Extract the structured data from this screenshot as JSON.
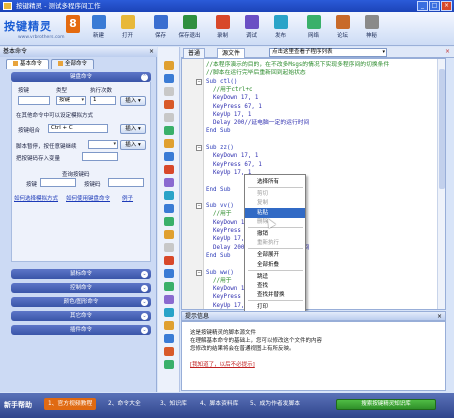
{
  "window": {
    "title": "按键精灵 - 测试多程序间工作"
  },
  "logo": {
    "text": "按键精灵",
    "version": "8",
    "url": "www.vrbrothers.com"
  },
  "toolbar": {
    "buttons": [
      {
        "label": "新建",
        "icon": "new-file-icon",
        "color": "#3a7bd5"
      },
      {
        "label": "打开",
        "icon": "open-folder-icon",
        "color": "#e8b83a"
      },
      {
        "label": "保存",
        "icon": "save-icon",
        "color": "#3a6ed0"
      },
      {
        "label": "保存退出",
        "icon": "save-exit-icon",
        "color": "#2f8f3f"
      },
      {
        "label": "录制",
        "icon": "record-icon",
        "color": "#d8482a"
      },
      {
        "label": "调试",
        "icon": "debug-icon",
        "color": "#6a4fc4"
      },
      {
        "label": "发布",
        "icon": "publish-icon",
        "color": "#2aa3c8"
      },
      {
        "label": "网络",
        "icon": "network-icon",
        "color": "#3ab06a"
      },
      {
        "label": "论坛",
        "icon": "forum-icon",
        "color": "#c86a2a"
      },
      {
        "label": "神秘",
        "icon": "mystery-icon",
        "color": "#8a8a8a"
      }
    ]
  },
  "left_panel": {
    "title": "基本命令",
    "tabs": [
      "基本命令",
      "全部命令"
    ],
    "keyboard": {
      "header": "键盘命令",
      "key_label": "按键",
      "type_label": "类型",
      "count_label": "执行次数",
      "key_value": "",
      "type_value": "按键",
      "count_value": "1",
      "insert": "插入",
      "insert_hint": "在其他命令中可以设定模拟方式",
      "combo_label": "按键组合",
      "combo_value": "Ctrl + C",
      "pause_label": "脚本暂停，按任意键继续",
      "save_label": "把按键码存入变量",
      "query_header": "查询按键码",
      "query_key": "按键",
      "query_code": "按键码",
      "link_simulate": "如何选择模拟方式",
      "link_all": "如何使用键盘命令",
      "link_example": "例子"
    },
    "groups": [
      "鼠标命令",
      "控制命令",
      "颜色/图形命令",
      "其它命令",
      "插件命令"
    ]
  },
  "editor": {
    "tabs": [
      "普通",
      "源文件"
    ],
    "sub_combo": "点击这里查看子程序列表",
    "lines": [
      {
        "text": "//本程序演示的目的，在不改多Msgs的情况下实现多程序间的切换条件",
        "kind": "comment"
      },
      {
        "text": "//脚本在运行完毕后重新回到起始状态",
        "kind": "comment"
      },
      {
        "text": "Sub ctl()",
        "kind": "kw",
        "fold": "−"
      },
      {
        "text": "  //用于ctrl+c",
        "kind": "comment"
      },
      {
        "text": "  KeyDown 17, 1",
        "kind": "plain"
      },
      {
        "text": "  KeyPress 67, 1",
        "kind": "plain"
      },
      {
        "text": "  KeyUp 17, 1",
        "kind": "plain"
      },
      {
        "text": "  Delay 200//延电脑一定的运行时间",
        "kind": "plain"
      },
      {
        "text": "End Sub",
        "kind": "kw"
      },
      {
        "text": "",
        "kind": "plain"
      },
      {
        "text": "Sub zz()",
        "kind": "kw",
        "fold": "−"
      },
      {
        "text": "  KeyDown 17, 1",
        "kind": "plain"
      },
      {
        "text": "  KeyPress 67, 1",
        "kind": "plain"
      },
      {
        "text": "  KeyUp 17, 1",
        "kind": "plain"
      },
      {
        "text": "  ",
        "kind": "plain"
      },
      {
        "text": "End Sub",
        "kind": "kw"
      },
      {
        "text": "",
        "kind": "plain"
      },
      {
        "text": "Sub vv()",
        "kind": "kw",
        "fold": "−"
      },
      {
        "text": "  //用于",
        "kind": "comment"
      },
      {
        "text": "  KeyDown 17, 1",
        "kind": "plain"
      },
      {
        "text": "  KeyPress 67, 1",
        "kind": "plain"
      },
      {
        "text": "  KeyUp 17, 1",
        "kind": "plain"
      },
      {
        "text": "  Delay 200//延电脑一定的运行时间",
        "kind": "plain"
      },
      {
        "text": "End Sub",
        "kind": "kw"
      },
      {
        "text": "",
        "kind": "plain"
      },
      {
        "text": "Sub ww()",
        "kind": "kw",
        "fold": "−"
      },
      {
        "text": "  //用于",
        "kind": "comment"
      },
      {
        "text": "  KeyDown 17, 1",
        "kind": "plain"
      },
      {
        "text": "  KeyPress 67, 1",
        "kind": "plain"
      },
      {
        "text": "  KeyUp 17, 1",
        "kind": "plain"
      }
    ]
  },
  "context_menu": {
    "items": [
      {
        "label": "选择所有",
        "state": "normal"
      },
      {
        "sep": true
      },
      {
        "label": "剪切",
        "state": "disabled"
      },
      {
        "label": "复制",
        "state": "disabled"
      },
      {
        "label": "粘贴",
        "state": "hover"
      },
      {
        "label": "删除",
        "state": "disabled"
      },
      {
        "sep": true
      },
      {
        "label": "撤销",
        "state": "normal"
      },
      {
        "label": "重新执行",
        "state": "disabled"
      },
      {
        "sep": true
      },
      {
        "label": "全部展开",
        "state": "normal"
      },
      {
        "label": "全部折叠",
        "state": "normal"
      },
      {
        "sep": true
      },
      {
        "label": "跳迳",
        "state": "normal"
      },
      {
        "label": "查找",
        "state": "normal"
      },
      {
        "label": "查找并替换",
        "state": "normal"
      },
      {
        "sep": true
      },
      {
        "label": "打印",
        "state": "normal"
      }
    ]
  },
  "info_panel": {
    "title": "提示信息",
    "lines": [
      "这是按键精灵的脚本源文件",
      "在理解基本命令的基础上，您可以修改这个文件的内容",
      "您修改的结果将会在普通视图上有所反映。"
    ],
    "footer": "[我知道了，以后不必提示]"
  },
  "footer": {
    "label": "新手帮助",
    "tabs": [
      "1、官方视频教程",
      "2、命令大全",
      "3、知识库",
      "4、脚本资料库",
      "5、成为作者发脚本"
    ],
    "search": "搜索按键精灵知识库"
  }
}
